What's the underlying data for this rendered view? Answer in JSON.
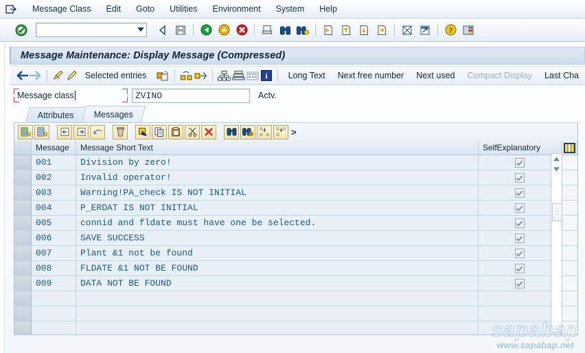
{
  "window": {
    "app_icon": "exit-arrow-icon",
    "menu": [
      {
        "label": "Message Class",
        "accel": "s"
      },
      {
        "label": "Edit",
        "accel": "E"
      },
      {
        "label": "Goto",
        "accel": "G"
      },
      {
        "label": "Utilities",
        "accel": "U"
      },
      {
        "label": "Environment",
        "accel": "v"
      },
      {
        "label": "System",
        "accel": "y"
      },
      {
        "label": "Help",
        "accel": "H"
      }
    ]
  },
  "standard_toolbar": {
    "enter_icon": "green-check-enter-icon",
    "command_field": {
      "value": "",
      "placeholder": ""
    },
    "icons": [
      "back-triangle-icon",
      "save-disk-icon",
      "back-green-arrow-icon",
      "exit-yellow-arrow-icon",
      "cancel-red-x-icon",
      "print-icon",
      "find-binoculars-icon",
      "find-next-binoculars-icon",
      "first-page-icon",
      "previous-page-icon",
      "next-page-icon",
      "last-page-icon",
      "create-session-icon",
      "create-shortcut-icon",
      "help-question-icon",
      "customize-layout-icon"
    ]
  },
  "title": "Message Maintenance: Display Message (Compressed)",
  "app_toolbar": {
    "icons": [
      "back-arrow-icon",
      "forward-arrow-icon",
      "display-change-pencil-icon",
      "edit-pencil-icon"
    ],
    "buttons": [
      {
        "label": "Selected entries",
        "disabled": false
      },
      {
        "label": "Long Text",
        "disabled": false
      },
      {
        "label": "Next free number",
        "disabled": false
      },
      {
        "label": "Next used",
        "disabled": false
      },
      {
        "label": "Compact Display",
        "disabled": true
      },
      {
        "label": "Last Cha",
        "disabled": false
      }
    ],
    "mid_icons": [
      "copy-object-icon",
      "where-used-icon",
      "expand-nodes-icon",
      "hierarchy-icon",
      "stack-icon",
      "list-icon",
      "information-icon"
    ]
  },
  "selection": {
    "label": "Message class",
    "value": "ZVINO",
    "status": "Actv."
  },
  "tabs": [
    {
      "label": "Attributes",
      "active": false
    },
    {
      "label": "Messages",
      "active": true
    }
  ],
  "grid_toolbar": {
    "buttons": [
      "append-row-icon",
      "insert-row-icon",
      "undo-back-icon",
      "redo-forward-icon",
      "refresh-undo-icon",
      "delete-trash-icon",
      "select-icon",
      "copy-icon",
      "paste-icon",
      "cut-scissors-icon",
      "delete-red-x-icon",
      "find-binoculars-icon",
      "find-next-binoculars-icon",
      "sort-ascending-icon",
      "sort-descending-icon"
    ],
    "more_label": ">"
  },
  "table": {
    "columns": [
      "Message",
      "Message Short Text",
      "SelfExplanatory"
    ],
    "config_icon": "column-config-icon",
    "rows": [
      {
        "message": "001",
        "text": "Division by zero!",
        "self_explanatory": true
      },
      {
        "message": "002",
        "text": "Invalid operator!",
        "self_explanatory": true
      },
      {
        "message": "003",
        "text": "Warning!PA_check IS NOT INITIAL",
        "self_explanatory": true
      },
      {
        "message": "004",
        "text": "P_ERDAT IS NOT INITIAL",
        "self_explanatory": true
      },
      {
        "message": "005",
        "text": "connid and fldate must have one be selected.",
        "self_explanatory": true
      },
      {
        "message": "006",
        "text": "SAVE SUCCESS",
        "self_explanatory": true
      },
      {
        "message": "007",
        "text": "Plant &1 not be found",
        "self_explanatory": true
      },
      {
        "message": "008",
        "text": "FLDATE &1 NOT BE FOUND",
        "self_explanatory": true
      },
      {
        "message": "009",
        "text": "DATA NOT BE FOUND",
        "self_explanatory": true
      },
      {
        "message": "",
        "text": "",
        "self_explanatory": false
      },
      {
        "message": "",
        "text": "",
        "self_explanatory": false
      },
      {
        "message": "",
        "text": "",
        "self_explanatory": false
      }
    ]
  },
  "scrollbar": {
    "up_arrow": "scroll-up-icon",
    "down_arrow": "scroll-down-icon",
    "grip": "scroll-grip-icon"
  },
  "watermark": {
    "brand": "sapabap",
    "url": "www.sapabap.net"
  },
  "colors": {
    "accent": "#1b5a80",
    "titlebar": "#cfdeee",
    "grid_cell": "#e8f0f7",
    "toolbar_button": "#f3e6b4",
    "field_marker": "#d44a55"
  }
}
